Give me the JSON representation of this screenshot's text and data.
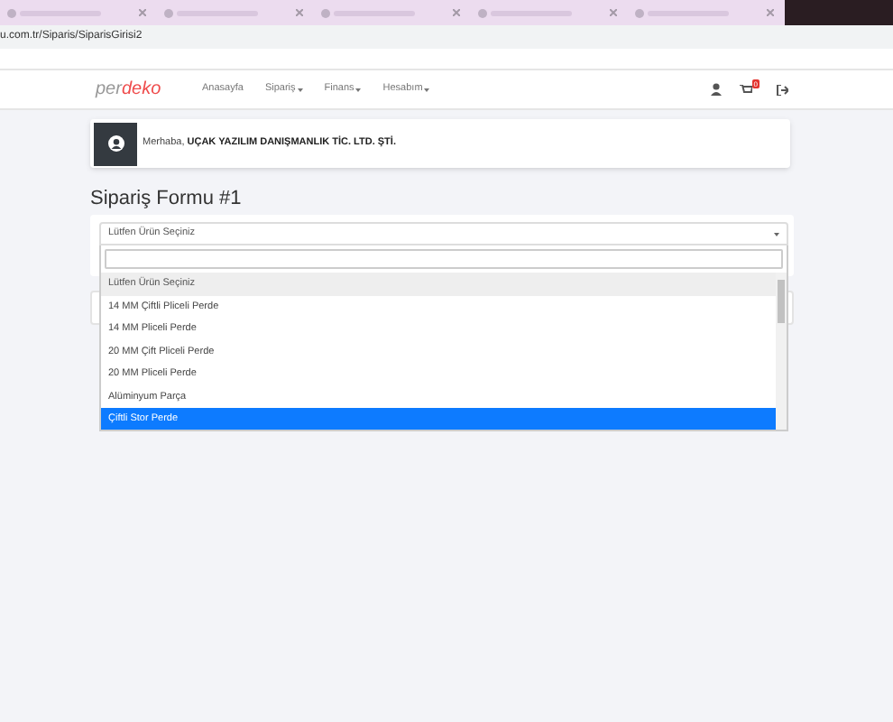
{
  "browser": {
    "address": "u.com.tr/Siparis/SiparisGirisi2"
  },
  "navbar": {
    "logo": [
      "per",
      "deko"
    ],
    "items": [
      {
        "label": "Anasayfa",
        "dropdown": false
      },
      {
        "label": "Sipariş",
        "dropdown": true
      },
      {
        "label": "Finans",
        "dropdown": true
      },
      {
        "label": "Hesabım",
        "dropdown": true
      }
    ],
    "cart_badge": "0"
  },
  "greeting": "Merhaba, **UÇAK YAZILIM DANIŞMANLIK TİC. LTD. ŞTİ.**",
  "form": {
    "title": "Sipariş Formu #1",
    "select_value": "Lütfen Ürün Seçiniz",
    "options": [
      {
        "label": "Lütfen Ürün Seçiniz",
        "selected": true,
        "highlighted": false
      },
      {
        "label": "14 MM Çiftli Pliceli Perde",
        "selected": false,
        "highlighted": false
      },
      {
        "label": "14 MM Pliceli Perde",
        "selected": false,
        "highlighted": false
      },
      {
        "label": "20 MM Çift Pliceli Perde",
        "selected": false,
        "highlighted": false
      },
      {
        "label": "20 MM Pliceli Perde",
        "selected": false,
        "highlighted": false
      },
      {
        "label": "Alüminyum Parça",
        "selected": false,
        "highlighted": false
      },
      {
        "label": "Çiftli Stor Perde",
        "selected": false,
        "highlighted": true
      }
    ]
  }
}
